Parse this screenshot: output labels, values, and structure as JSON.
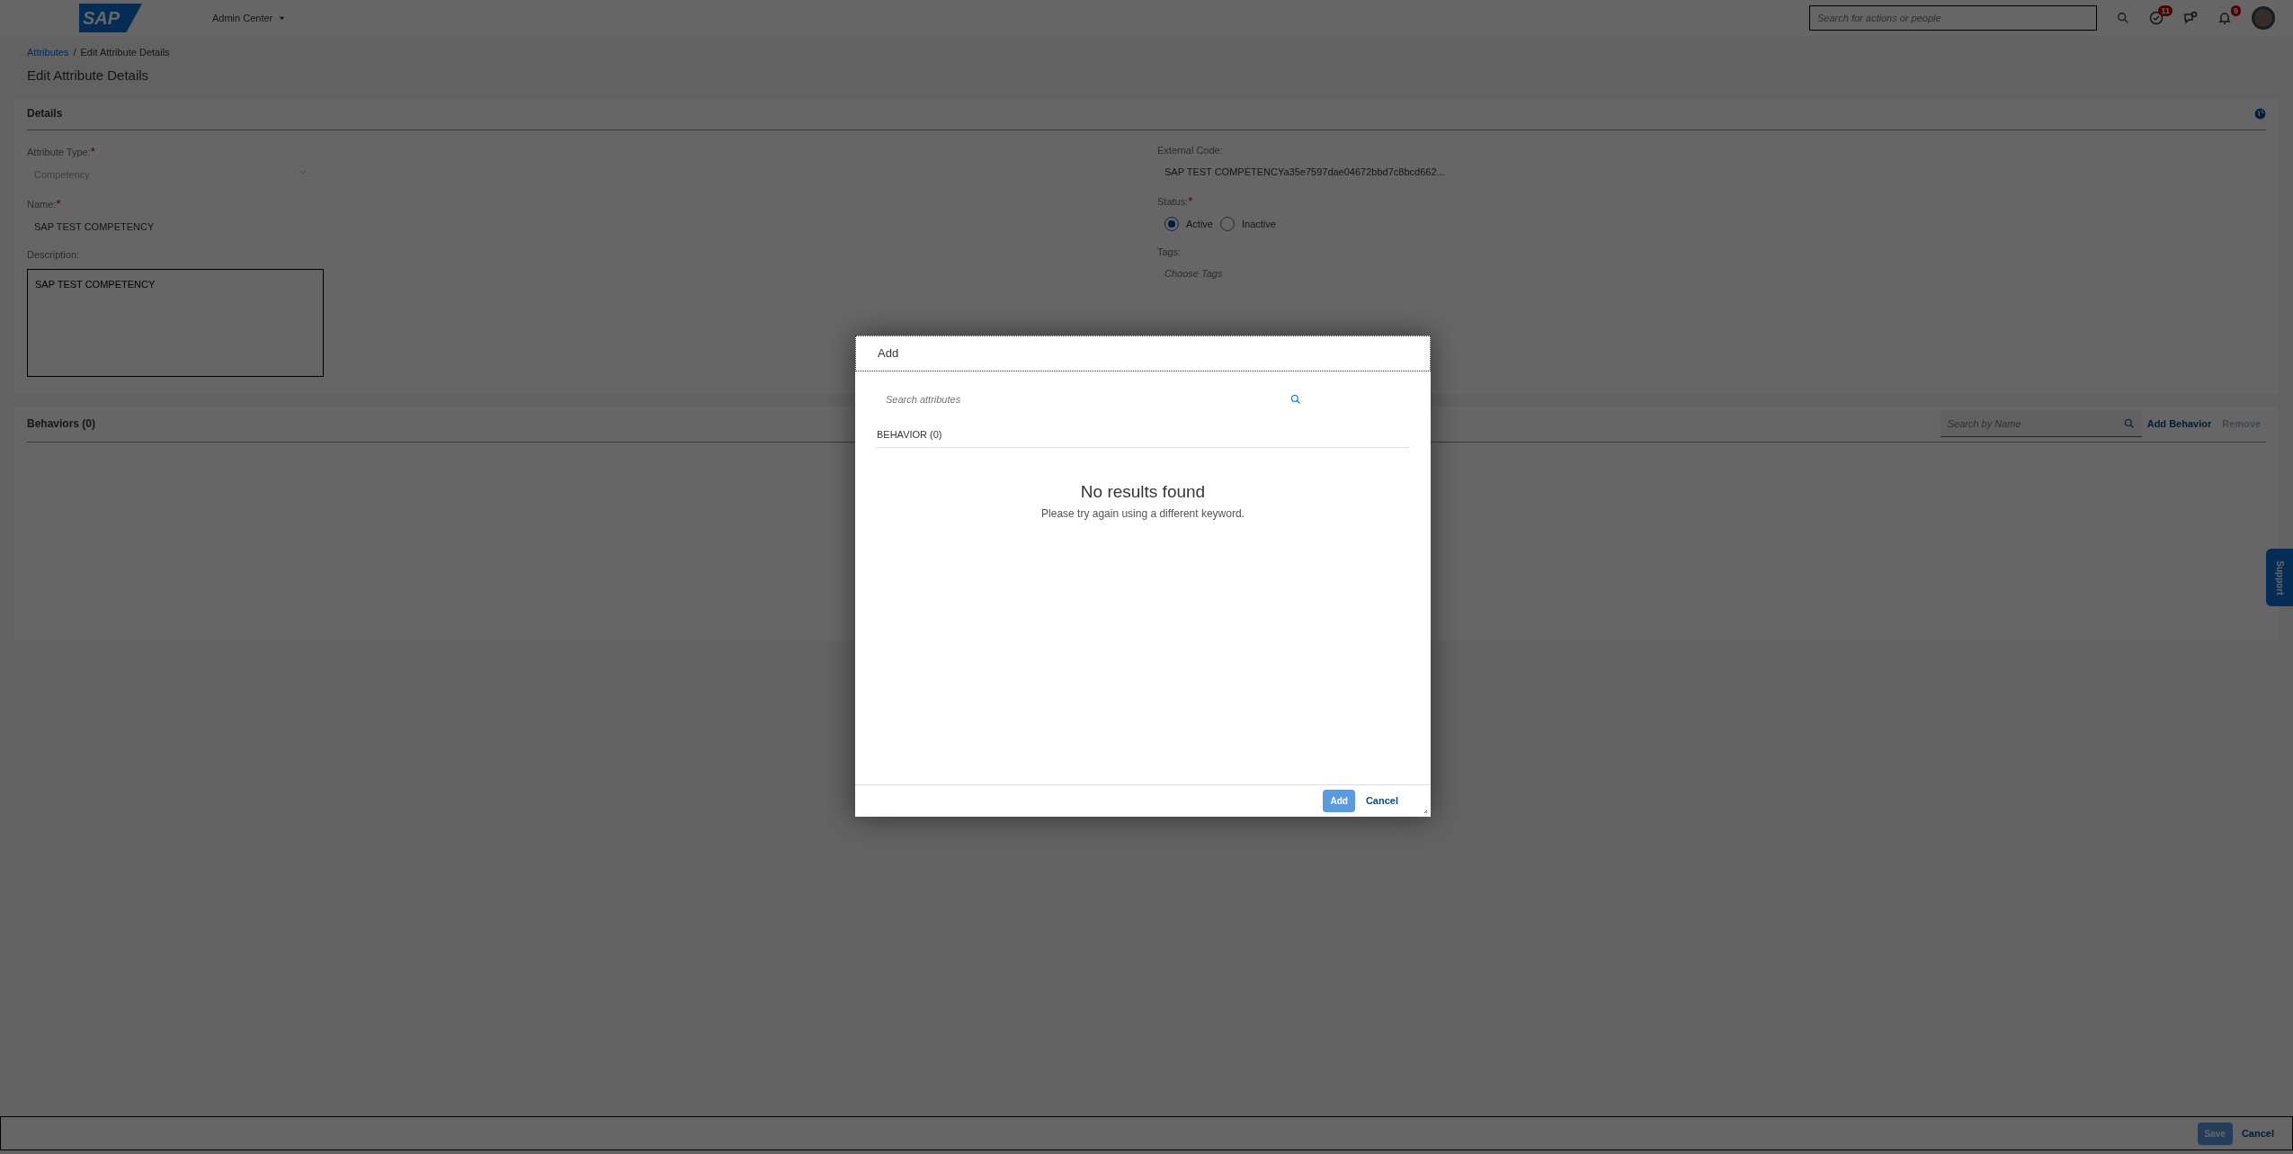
{
  "header": {
    "logo": "SAP",
    "app_menu": "Admin Center",
    "search": {
      "placeholder": "Search for actions or people"
    },
    "icons": [
      {
        "kind": "search"
      },
      {
        "kind": "tasks",
        "count": "11"
      },
      {
        "kind": "chat"
      },
      {
        "kind": "notifications",
        "count": "9"
      },
      {
        "kind": "avatar"
      }
    ]
  },
  "breadcrumb": [
    {
      "label": "Attributes",
      "link": true
    },
    {
      "label": "Edit Attribute Details",
      "link": false
    }
  ],
  "breadcrumb_separator": "/",
  "page_title": "Edit Attribute Details",
  "details": {
    "title": "Details",
    "left": [
      {
        "kind": "select",
        "label": "Attribute Type:",
        "required_mark": "*",
        "value": "Competency",
        "disabled": true
      },
      {
        "kind": "text",
        "label": "Name:",
        "required_mark": "*",
        "value": "SAP TEST COMPETENCY"
      },
      {
        "kind": "textarea",
        "label": "Description:",
        "value": "SAP TEST COMPETENCY"
      }
    ],
    "right": [
      {
        "kind": "text",
        "label": "External Code:",
        "value": "SAP TEST COMPETENCYa35e7597dae04672bbd7c8bcd662..."
      },
      {
        "kind": "radio",
        "label": "Status:",
        "required_mark": "*",
        "options": [
          {
            "label": "Active",
            "selected": true
          },
          {
            "label": "Inactive",
            "selected": false
          }
        ]
      },
      {
        "kind": "tags",
        "label": "Tags:",
        "placeholder": "Choose Tags"
      }
    ]
  },
  "behaviors": {
    "title": "Behaviors (0)",
    "search": {
      "placeholder": "Search by Name"
    },
    "actions": [
      {
        "label": "Add Behavior",
        "disabled": false
      },
      {
        "label": "Remove",
        "disabled": true
      }
    ]
  },
  "support_tab": "Support",
  "footer": {
    "buttons": [
      {
        "label": "Save",
        "kind": "primary",
        "disabled": true
      },
      {
        "label": "Cancel",
        "kind": "link",
        "disabled": false
      }
    ]
  },
  "dialog": {
    "title": "Add",
    "search": {
      "placeholder": "Search attributes"
    },
    "section": "BEHAVIOR (0)",
    "empty_title": "No results found",
    "empty_text": "Please try again using a different keyword.",
    "buttons": [
      {
        "label": "Add",
        "kind": "primary",
        "disabled": true
      },
      {
        "label": "Cancel",
        "kind": "link",
        "disabled": false
      }
    ]
  }
}
